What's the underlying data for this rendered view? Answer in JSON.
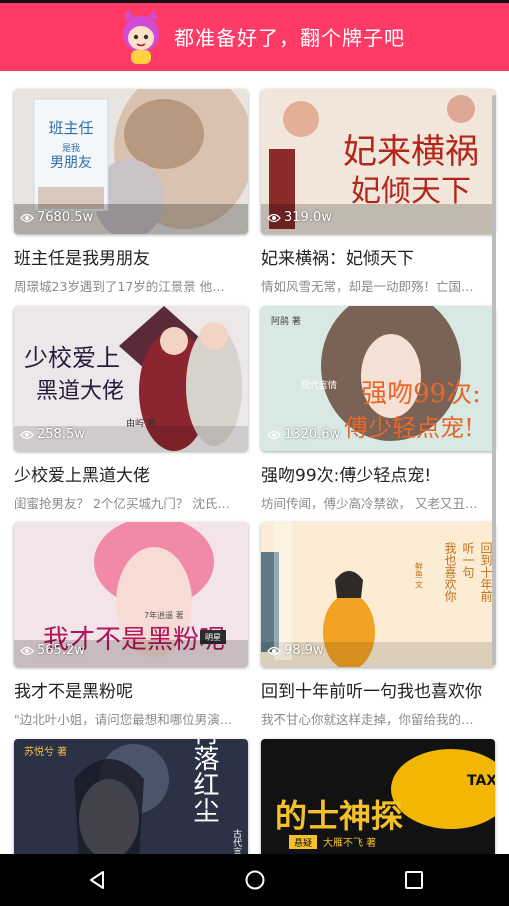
{
  "header": {
    "title": "都准备好了，翻个牌子吧"
  },
  "books": [
    {
      "title": "班主任是我男朋友",
      "views": "7680.5w",
      "desc": "周璟城23岁遇到了17岁的江景景 他恰好...",
      "cover_text": [
        "班主任",
        "是我",
        "男朋友"
      ]
    },
    {
      "title": "妃来横祸：妃倾天下",
      "views": "319.0w",
      "desc": "情如风雪无常，却是一动即殇！亡国公...",
      "cover_text": [
        "妃来横祸",
        "妃倾天下"
      ]
    },
    {
      "title": "少校爱上黑道大佬",
      "views": "258.5w",
      "desc": "闺蜜抢男友？ 2个亿买城九门？ 沈氏集...",
      "cover_text": [
        "少校爱上",
        "黑道大佬",
        "由屿 著"
      ]
    },
    {
      "title": "强吻99次:傅少轻点宠!",
      "views": "1320.6w",
      "desc": "坊间传闻，傅少高冷禁欲， 又老又丑，...",
      "cover_text": [
        "强吻99次:",
        "傅少轻点宠!",
        "现代言情",
        "阿鹃 著"
      ]
    },
    {
      "title": "我才不是黑粉呢",
      "views": "565.2w",
      "desc": "\"边北叶小姐，请问您最想和哪位男演员...",
      "cover_text": [
        "我才不是黑粉呢",
        "7年逍遥 著",
        "明星"
      ]
    },
    {
      "title": "回到十年前听一句我也喜欢你",
      "views": "98.9w",
      "desc": "我不甘心你就这样走掉，你留给我的那...",
      "cover_text": [
        "回到十年前",
        "听一句",
        "我也喜欢你",
        "鲜鱼 文"
      ]
    },
    {
      "title": "",
      "views": "",
      "desc": "",
      "cover_text": [
        "再落红尘",
        "古代言情",
        "苏悦兮 著"
      ]
    },
    {
      "title": "",
      "views": "",
      "desc": "",
      "cover_text": [
        "的士神探",
        "悬疑",
        "大雁不飞 著",
        "TAXI"
      ]
    }
  ],
  "colors": {
    "brand": "#fe3b66",
    "navbar": "#000000"
  },
  "icons": {
    "view": "eye-icon",
    "mascot": "mascot-icon",
    "back": "back-icon",
    "home": "home-icon",
    "recents": "recents-icon"
  }
}
